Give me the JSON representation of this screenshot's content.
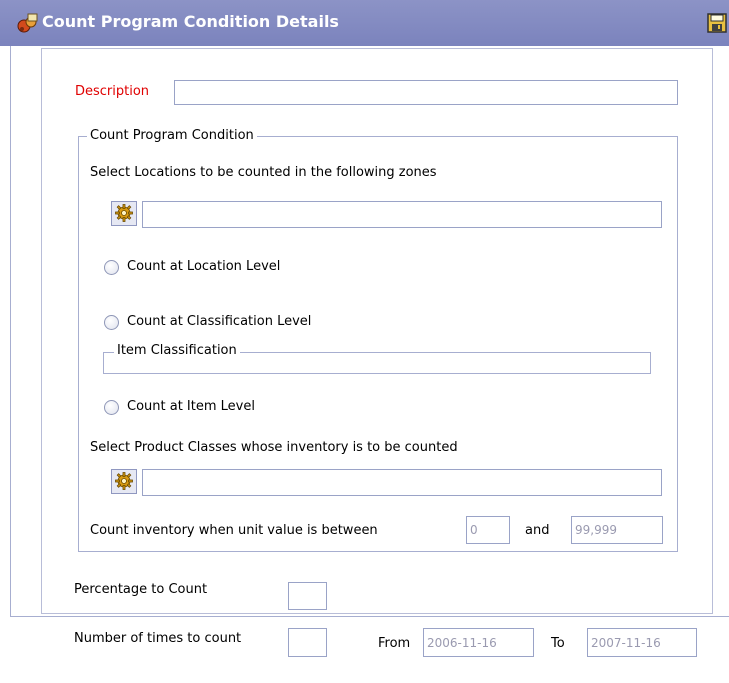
{
  "window": {
    "title": "Count Program Condition Details"
  },
  "form": {
    "description_label": "Description",
    "description_value": "",
    "condition_group_label": "Count Program Condition",
    "zones_label": "Select Locations to be counted in the following zones",
    "zones_value": "",
    "radio_location_label": "Count at Location Level",
    "radio_classification_label": "Count at Classification Level",
    "item_classification_label": "Item Classification",
    "radio_item_label": "Count at Item Level",
    "product_classes_label": "Select Product Classes whose inventory is to be counted",
    "product_classes_value": "",
    "unit_value_label": "Count inventory when unit value is between",
    "unit_value_min": "0",
    "and_label": "and",
    "unit_value_max": "99,999",
    "percentage_label": "Percentage to Count",
    "percentage_value": "",
    "times_label": "Number of times to count",
    "times_value": "",
    "from_label": "From",
    "from_date": "2006-11-16",
    "to_label": "To",
    "to_date": "2007-11-16"
  },
  "colors": {
    "title_bar": "#8088c0",
    "required_label": "#e00000",
    "border": "#a7aed0"
  },
  "icons": {
    "title": "count-program-icon",
    "save": "floppy-save-icon",
    "lookup": "gear-lookup-icon"
  }
}
